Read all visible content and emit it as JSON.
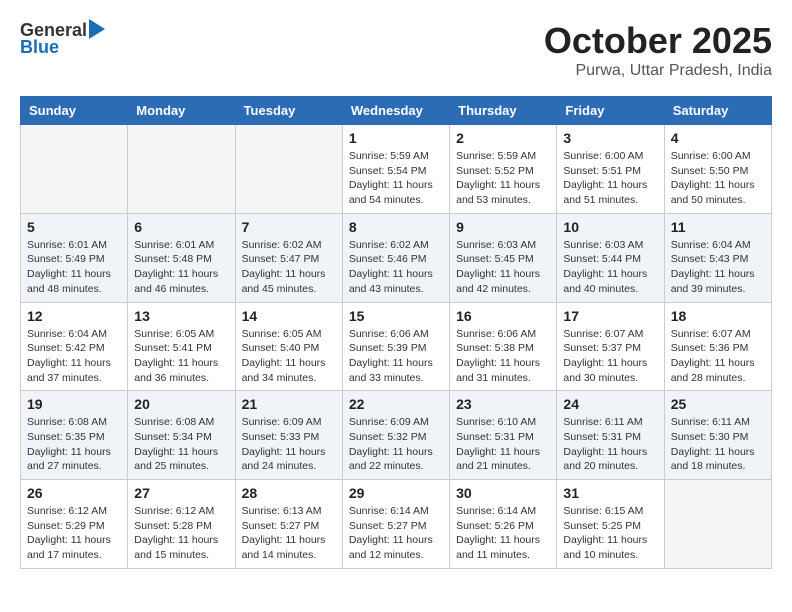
{
  "header": {
    "logo": {
      "general": "General",
      "blue": "Blue"
    },
    "title": "October 2025",
    "subtitle": "Purwa, Uttar Pradesh, India"
  },
  "days_of_week": [
    "Sunday",
    "Monday",
    "Tuesday",
    "Wednesday",
    "Thursday",
    "Friday",
    "Saturday"
  ],
  "weeks": [
    [
      {
        "day": "",
        "info": ""
      },
      {
        "day": "",
        "info": ""
      },
      {
        "day": "",
        "info": ""
      },
      {
        "day": "1",
        "info": "Sunrise: 5:59 AM\nSunset: 5:54 PM\nDaylight: 11 hours and 54 minutes."
      },
      {
        "day": "2",
        "info": "Sunrise: 5:59 AM\nSunset: 5:52 PM\nDaylight: 11 hours and 53 minutes."
      },
      {
        "day": "3",
        "info": "Sunrise: 6:00 AM\nSunset: 5:51 PM\nDaylight: 11 hours and 51 minutes."
      },
      {
        "day": "4",
        "info": "Sunrise: 6:00 AM\nSunset: 5:50 PM\nDaylight: 11 hours and 50 minutes."
      }
    ],
    [
      {
        "day": "5",
        "info": "Sunrise: 6:01 AM\nSunset: 5:49 PM\nDaylight: 11 hours and 48 minutes."
      },
      {
        "day": "6",
        "info": "Sunrise: 6:01 AM\nSunset: 5:48 PM\nDaylight: 11 hours and 46 minutes."
      },
      {
        "day": "7",
        "info": "Sunrise: 6:02 AM\nSunset: 5:47 PM\nDaylight: 11 hours and 45 minutes."
      },
      {
        "day": "8",
        "info": "Sunrise: 6:02 AM\nSunset: 5:46 PM\nDaylight: 11 hours and 43 minutes."
      },
      {
        "day": "9",
        "info": "Sunrise: 6:03 AM\nSunset: 5:45 PM\nDaylight: 11 hours and 42 minutes."
      },
      {
        "day": "10",
        "info": "Sunrise: 6:03 AM\nSunset: 5:44 PM\nDaylight: 11 hours and 40 minutes."
      },
      {
        "day": "11",
        "info": "Sunrise: 6:04 AM\nSunset: 5:43 PM\nDaylight: 11 hours and 39 minutes."
      }
    ],
    [
      {
        "day": "12",
        "info": "Sunrise: 6:04 AM\nSunset: 5:42 PM\nDaylight: 11 hours and 37 minutes."
      },
      {
        "day": "13",
        "info": "Sunrise: 6:05 AM\nSunset: 5:41 PM\nDaylight: 11 hours and 36 minutes."
      },
      {
        "day": "14",
        "info": "Sunrise: 6:05 AM\nSunset: 5:40 PM\nDaylight: 11 hours and 34 minutes."
      },
      {
        "day": "15",
        "info": "Sunrise: 6:06 AM\nSunset: 5:39 PM\nDaylight: 11 hours and 33 minutes."
      },
      {
        "day": "16",
        "info": "Sunrise: 6:06 AM\nSunset: 5:38 PM\nDaylight: 11 hours and 31 minutes."
      },
      {
        "day": "17",
        "info": "Sunrise: 6:07 AM\nSunset: 5:37 PM\nDaylight: 11 hours and 30 minutes."
      },
      {
        "day": "18",
        "info": "Sunrise: 6:07 AM\nSunset: 5:36 PM\nDaylight: 11 hours and 28 minutes."
      }
    ],
    [
      {
        "day": "19",
        "info": "Sunrise: 6:08 AM\nSunset: 5:35 PM\nDaylight: 11 hours and 27 minutes."
      },
      {
        "day": "20",
        "info": "Sunrise: 6:08 AM\nSunset: 5:34 PM\nDaylight: 11 hours and 25 minutes."
      },
      {
        "day": "21",
        "info": "Sunrise: 6:09 AM\nSunset: 5:33 PM\nDaylight: 11 hours and 24 minutes."
      },
      {
        "day": "22",
        "info": "Sunrise: 6:09 AM\nSunset: 5:32 PM\nDaylight: 11 hours and 22 minutes."
      },
      {
        "day": "23",
        "info": "Sunrise: 6:10 AM\nSunset: 5:31 PM\nDaylight: 11 hours and 21 minutes."
      },
      {
        "day": "24",
        "info": "Sunrise: 6:11 AM\nSunset: 5:31 PM\nDaylight: 11 hours and 20 minutes."
      },
      {
        "day": "25",
        "info": "Sunrise: 6:11 AM\nSunset: 5:30 PM\nDaylight: 11 hours and 18 minutes."
      }
    ],
    [
      {
        "day": "26",
        "info": "Sunrise: 6:12 AM\nSunset: 5:29 PM\nDaylight: 11 hours and 17 minutes."
      },
      {
        "day": "27",
        "info": "Sunrise: 6:12 AM\nSunset: 5:28 PM\nDaylight: 11 hours and 15 minutes."
      },
      {
        "day": "28",
        "info": "Sunrise: 6:13 AM\nSunset: 5:27 PM\nDaylight: 11 hours and 14 minutes."
      },
      {
        "day": "29",
        "info": "Sunrise: 6:14 AM\nSunset: 5:27 PM\nDaylight: 11 hours and 12 minutes."
      },
      {
        "day": "30",
        "info": "Sunrise: 6:14 AM\nSunset: 5:26 PM\nDaylight: 11 hours and 11 minutes."
      },
      {
        "day": "31",
        "info": "Sunrise: 6:15 AM\nSunset: 5:25 PM\nDaylight: 11 hours and 10 minutes."
      },
      {
        "day": "",
        "info": ""
      }
    ]
  ]
}
